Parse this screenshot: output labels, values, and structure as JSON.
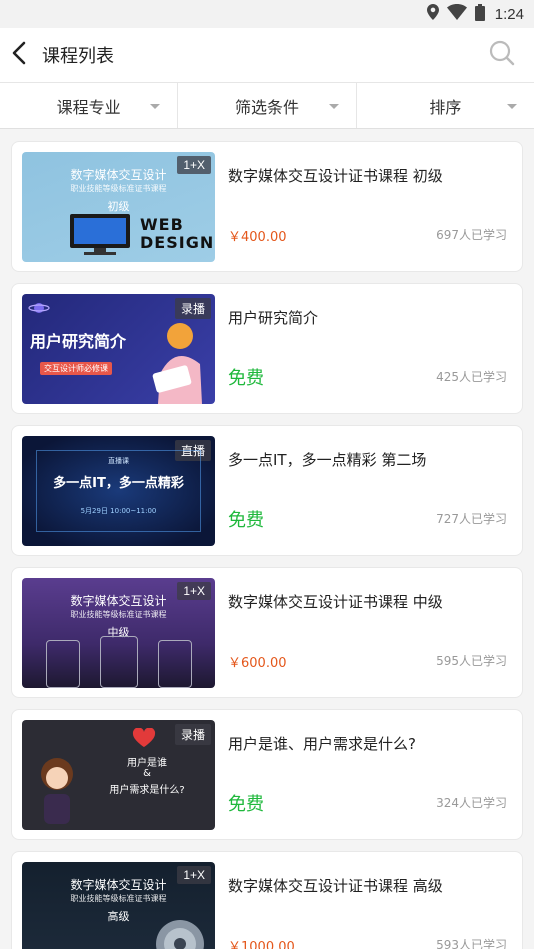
{
  "status_bar": {
    "time": "1:24"
  },
  "header": {
    "title": "课程列表"
  },
  "filters": [
    {
      "label": "课程专业"
    },
    {
      "label": "筛选条件"
    },
    {
      "label": "排序"
    }
  ],
  "courses": [
    {
      "title": "数字媒体交互设计证书课程 初级",
      "price": "￥400.00",
      "learners": "697人已学习",
      "badge": "1+X",
      "thumb_lines": [
        "数字媒体交互设计",
        "职业技能等级标准证书课程",
        "初级"
      ],
      "thumb_extra": "WEB DESIGN",
      "thumb_color": "#8fc3e0"
    },
    {
      "title": "用户研究简介",
      "price": "免费",
      "learners": "425人已学习",
      "badge": "录播",
      "thumb_lines": [
        "用户研究简介",
        "",
        "交互设计师必修课"
      ],
      "thumb_color": "#2a2f8a"
    },
    {
      "title": "多一点IT，多一点精彩 第二场",
      "price": "免费",
      "learners": "727人已学习",
      "badge": "直播",
      "thumb_lines": [
        "直播课",
        "多一点IT，多一点精彩",
        "5月29日 10:00~11:00"
      ],
      "thumb_color": "#0f1e4a"
    },
    {
      "title": "数字媒体交互设计证书课程  中级",
      "price": "￥600.00",
      "learners": "595人已学习",
      "badge": "1+X",
      "thumb_lines": [
        "数字媒体交互设计",
        "职业技能等级标准证书课程",
        "中级"
      ],
      "thumb_color": "#5a3d8f"
    },
    {
      "title": "用户是谁、用户需求是什么?",
      "price": "免费",
      "learners": "324人已学习",
      "badge": "录播",
      "thumb_lines": [
        "用户是谁",
        "&",
        "用户需求是什么?"
      ],
      "thumb_color": "#2c2c34"
    },
    {
      "title": "数字媒体交互设计证书课程 高级",
      "price": "￥1000.00",
      "learners": "593人已学习",
      "badge": "1+X",
      "thumb_lines": [
        "数字媒体交互设计",
        "职业技能等级标准证书课程",
        "高级"
      ],
      "thumb_color": "#162030"
    }
  ]
}
